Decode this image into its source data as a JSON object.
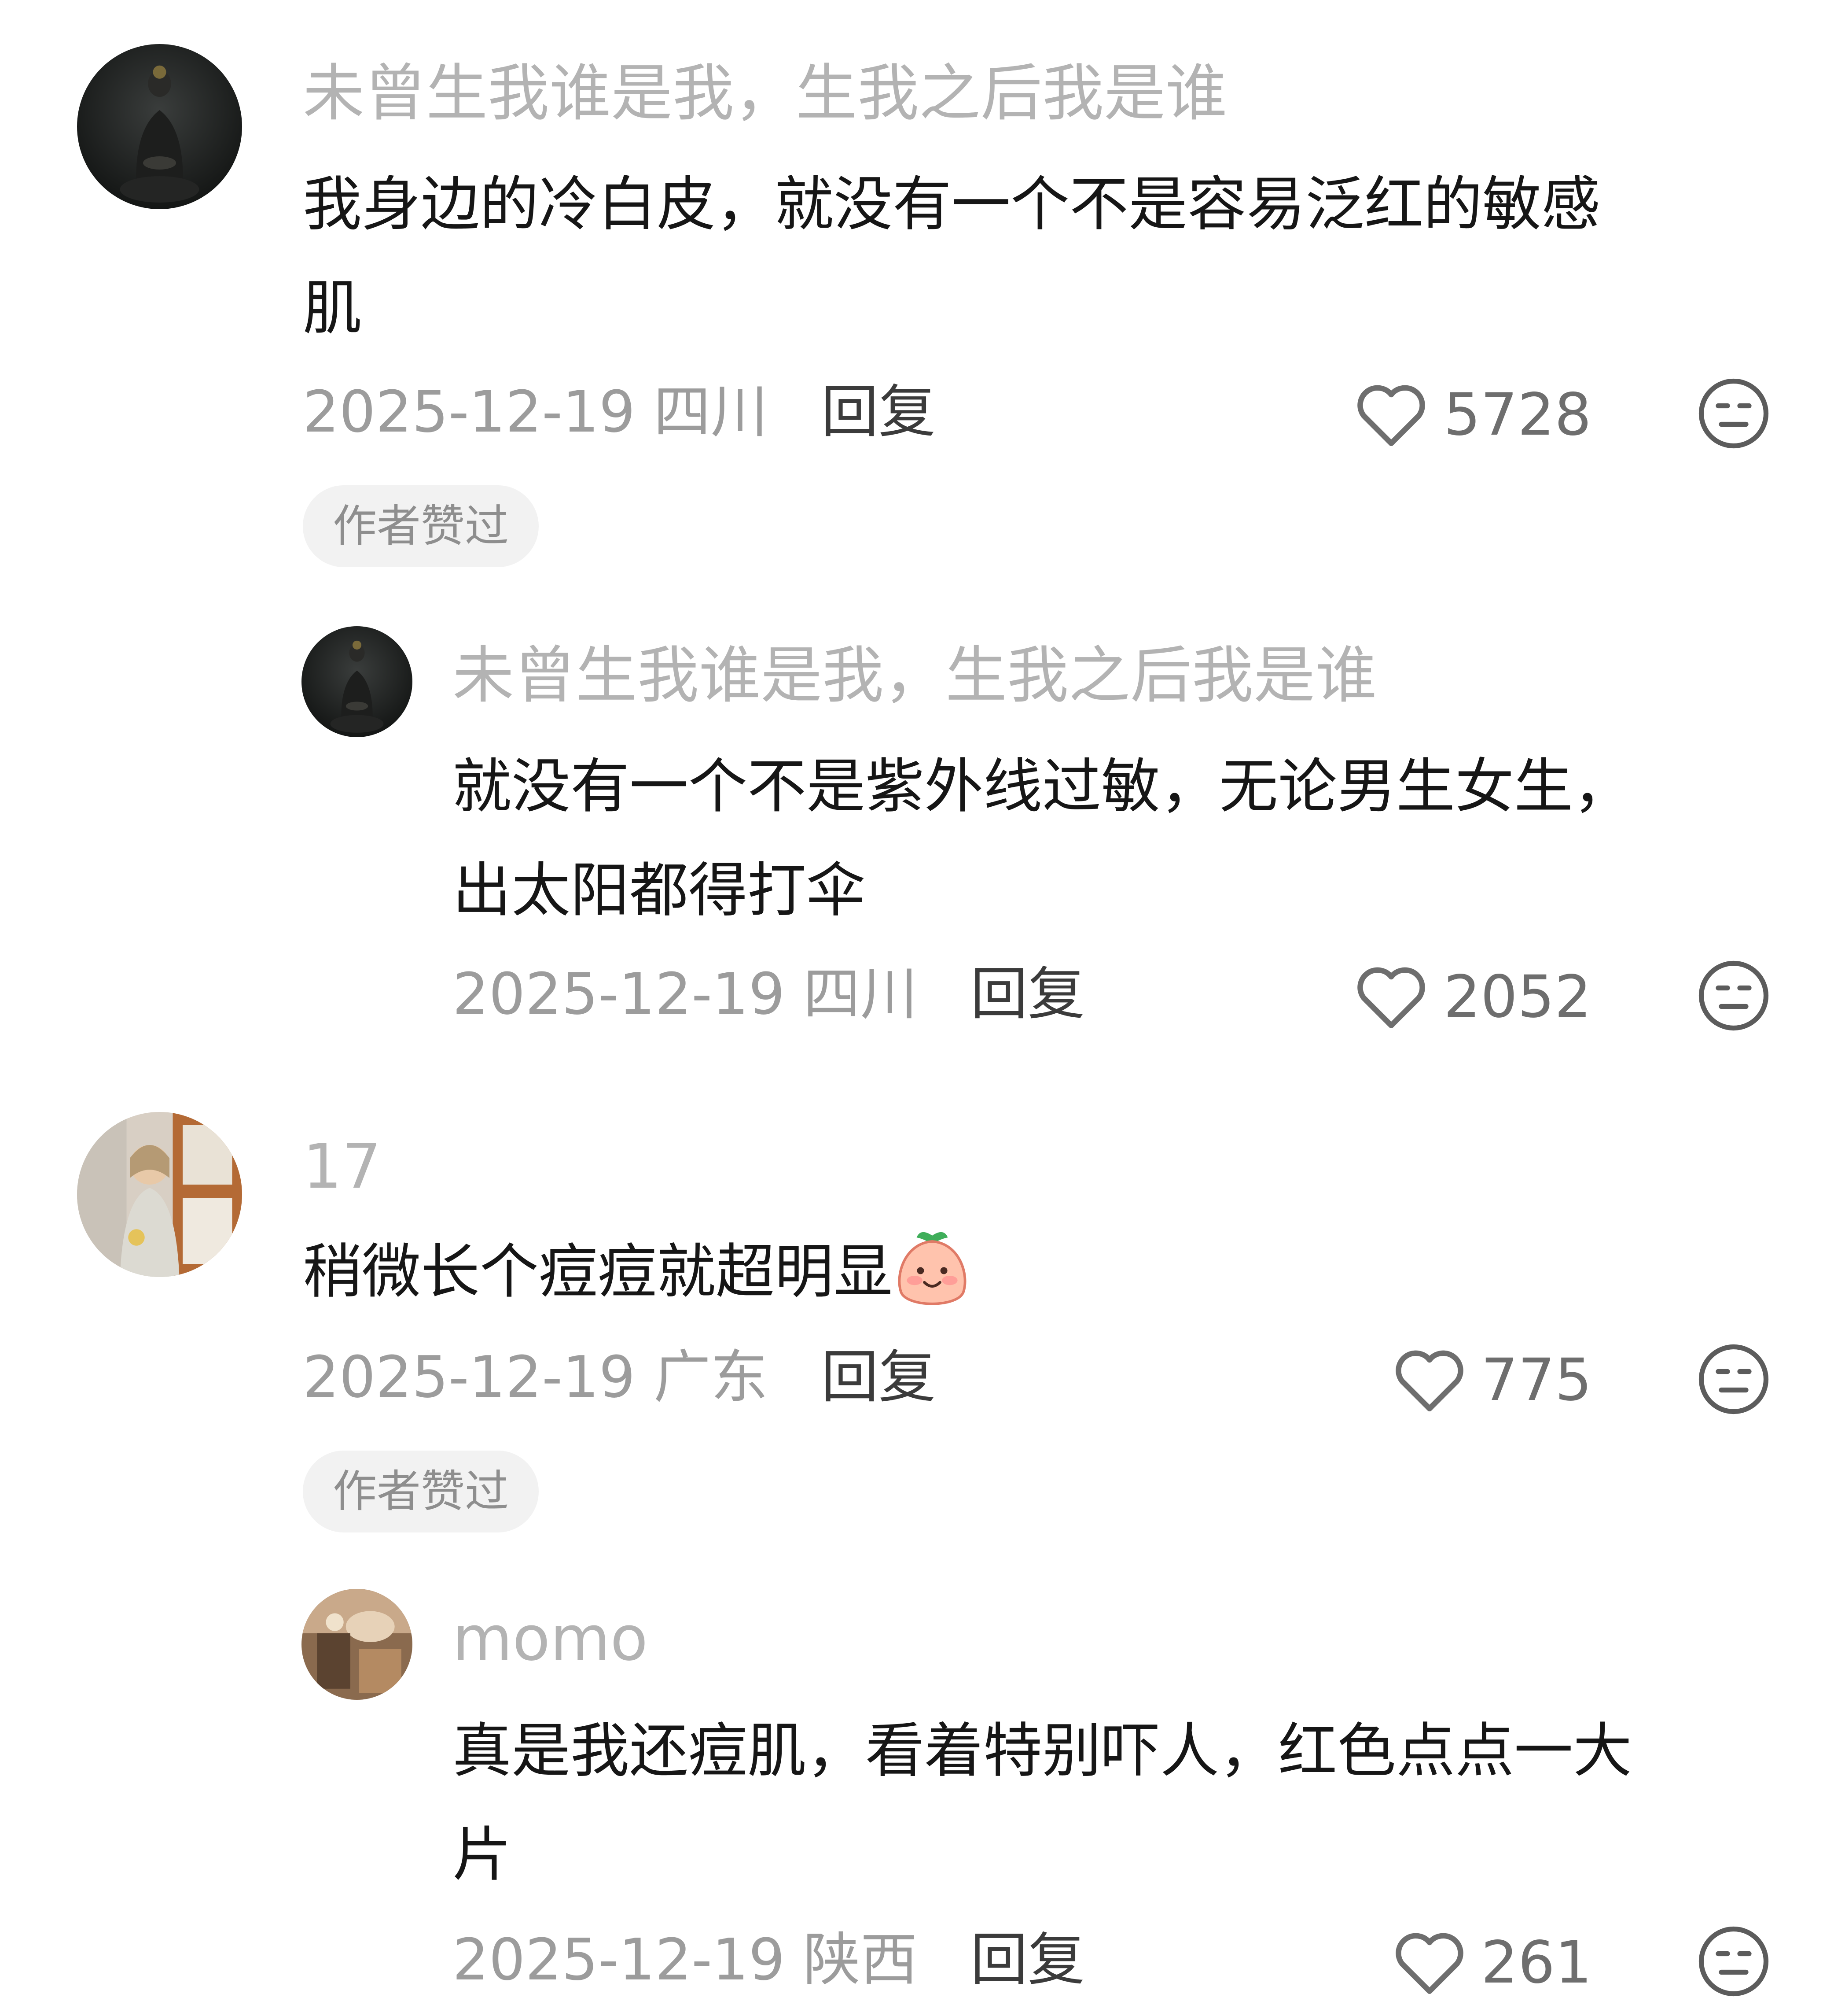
{
  "comments": [
    {
      "username": "未曾生我谁是我，生我之后我是谁",
      "text_line1": "我身边的冷白皮，就没有一个不是容易泛红的敏感",
      "text_line2": "肌",
      "date_location": "2025-12-19 四川",
      "reply_label": "回复",
      "likes": "5728",
      "author_badge": "作者赞过",
      "avatar": "buddha-statue",
      "reply": {
        "username": "未曾生我谁是我，生我之后我是谁",
        "text_line1": "就没有一个不是紫外线过敏，无论男生女生，",
        "text_line2": "出太阳都得打伞",
        "date_location": "2025-12-19 四川",
        "reply_label": "回复",
        "likes": "2052",
        "avatar": "buddha-statue"
      }
    },
    {
      "username": "17",
      "text_line1": "稍微长个痘痘就超明显",
      "emoji": "peach-blush-emoji",
      "date_location": "2025-12-19 广东",
      "reply_label": "回复",
      "likes": "775",
      "author_badge": "作者赞过",
      "avatar": "girl-by-window",
      "reply": {
        "username": "momo",
        "text_line1": "真是我还痘肌，看着特别吓人，红色点点一大",
        "text_line2": "片",
        "date_location": "2025-12-19 陕西",
        "reply_label": "回复",
        "likes": "261",
        "avatar": "warm-room-photo"
      }
    }
  ],
  "icons": {
    "like": "heart-outline-icon",
    "dislike": "meh-face-icon"
  },
  "colors": {
    "username": "#b3b3b3",
    "text": "#161616",
    "meta": "#9c9c9c",
    "badge_bg": "#f2f2f2"
  }
}
